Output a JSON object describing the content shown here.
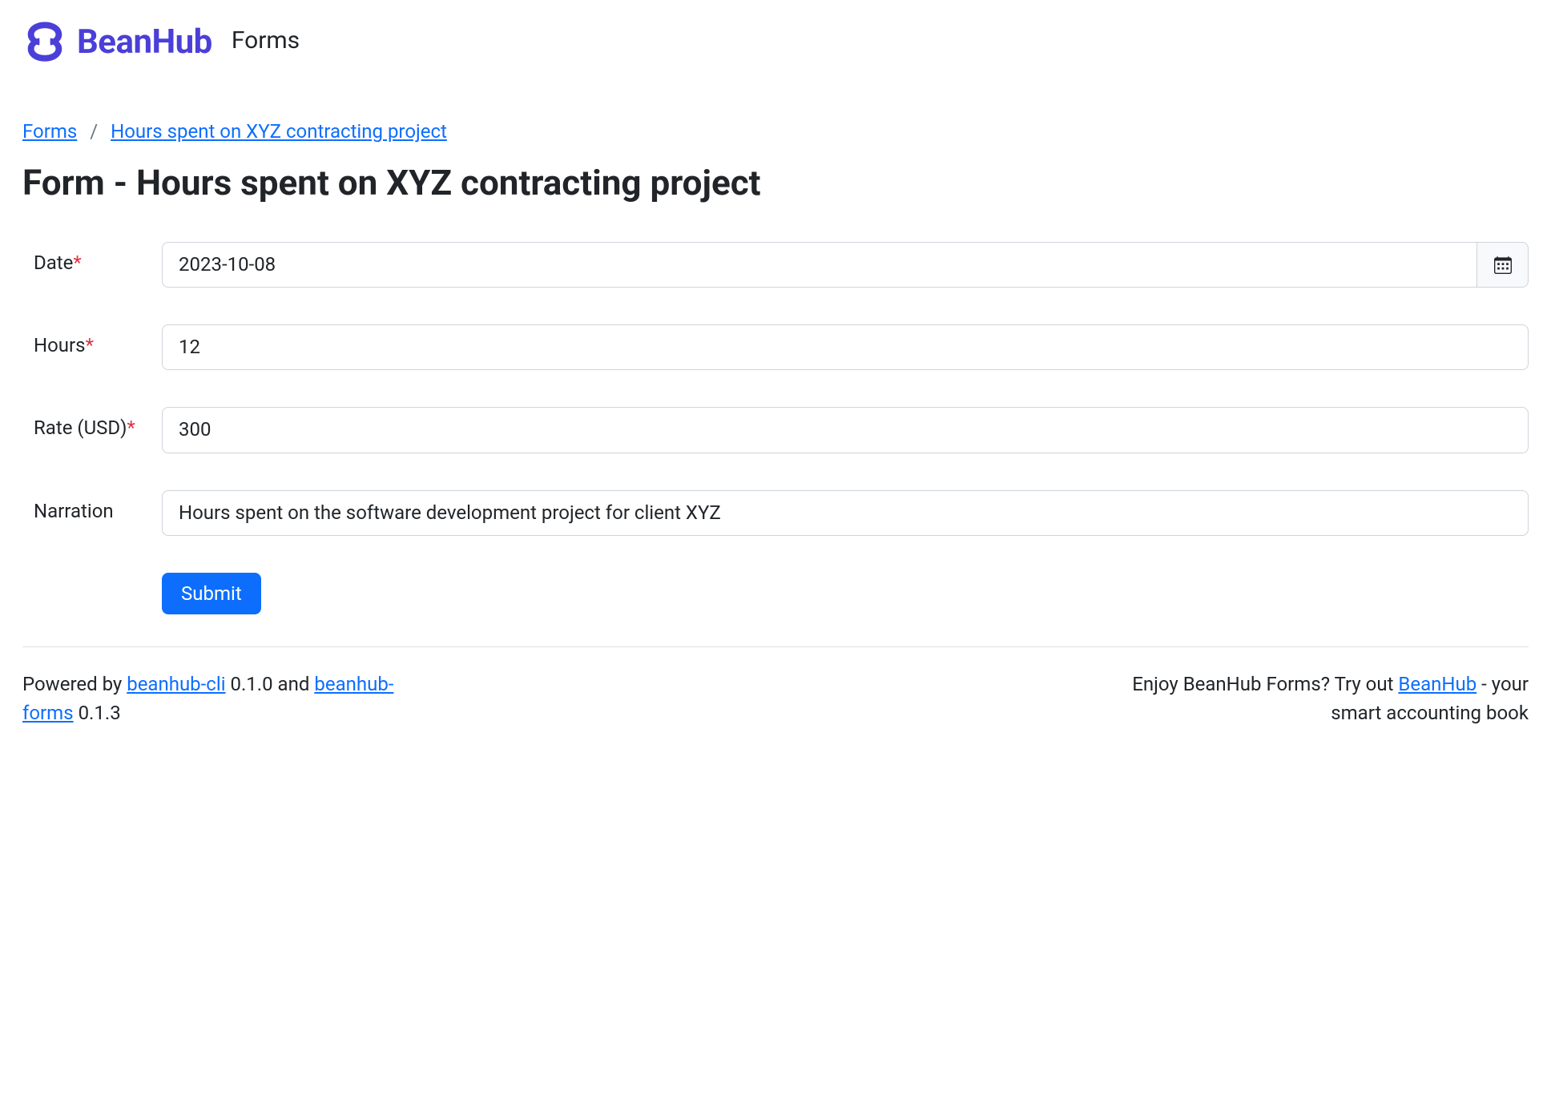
{
  "brand": {
    "name": "BeanHub",
    "section": "Forms"
  },
  "breadcrumb": {
    "root": "Forms",
    "sep": "/",
    "current": "Hours spent on XYZ contracting project"
  },
  "page": {
    "title": "Form - Hours spent on XYZ contracting project"
  },
  "form": {
    "date": {
      "label": "Date",
      "required": "*",
      "value": "2023-10-08"
    },
    "hours": {
      "label": "Hours",
      "required": "*",
      "value": "12"
    },
    "rate": {
      "label": "Rate (USD)",
      "required": "*",
      "value": "300"
    },
    "narration": {
      "label": "Narration",
      "value": "Hours spent on the software development project for client XYZ"
    },
    "submit": "Submit"
  },
  "footer": {
    "left_prefix": "Powered by ",
    "cli_link": "beanhub-cli",
    "cli_version": " 0.1.0 and ",
    "forms_link": "beanhub-forms",
    "forms_version": " 0.1.3",
    "right_prefix": "Enjoy BeanHub Forms? Try out ",
    "beanhub_link": "BeanHub",
    "right_suffix": " - your smart accounting book"
  }
}
